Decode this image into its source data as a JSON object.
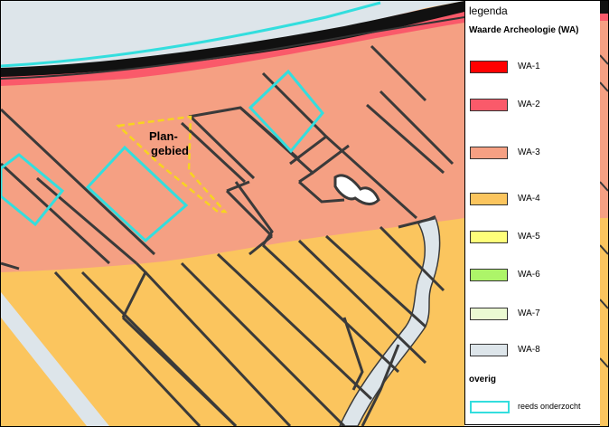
{
  "legend": {
    "title": "legenda",
    "subtitle": "Waarde Archeologie (WA)",
    "items": [
      {
        "label": "WA-1",
        "color": "#ff0000"
      },
      {
        "label": "WA-2",
        "color": "#fa5a6a"
      },
      {
        "label": "WA-3",
        "color": "#f5a083"
      },
      {
        "label": "WA-4",
        "color": "#fbc55e"
      },
      {
        "label": "WA-5",
        "color": "#ffff7a"
      },
      {
        "label": "WA-6",
        "color": "#adf569"
      },
      {
        "label": "WA-7",
        "color": "#ebfad2"
      },
      {
        "label": "WA-8",
        "color": "#dde5ea"
      }
    ],
    "overig_title": "overig",
    "overig_items": [
      {
        "label": "reeds onderzocht",
        "color": "#33dede"
      }
    ]
  },
  "map": {
    "plangebied_label_line1": "Plan-",
    "plangebied_label_line2": "gebied",
    "colors": {
      "wa3": "#f5a083",
      "wa4": "#fbc55e",
      "wa2": "#fa5a6a",
      "wa8": "#dde5ea",
      "parcel_line": "#3a3a3a",
      "surveyed": "#33dede",
      "plangebied": "#f7d420"
    }
  }
}
